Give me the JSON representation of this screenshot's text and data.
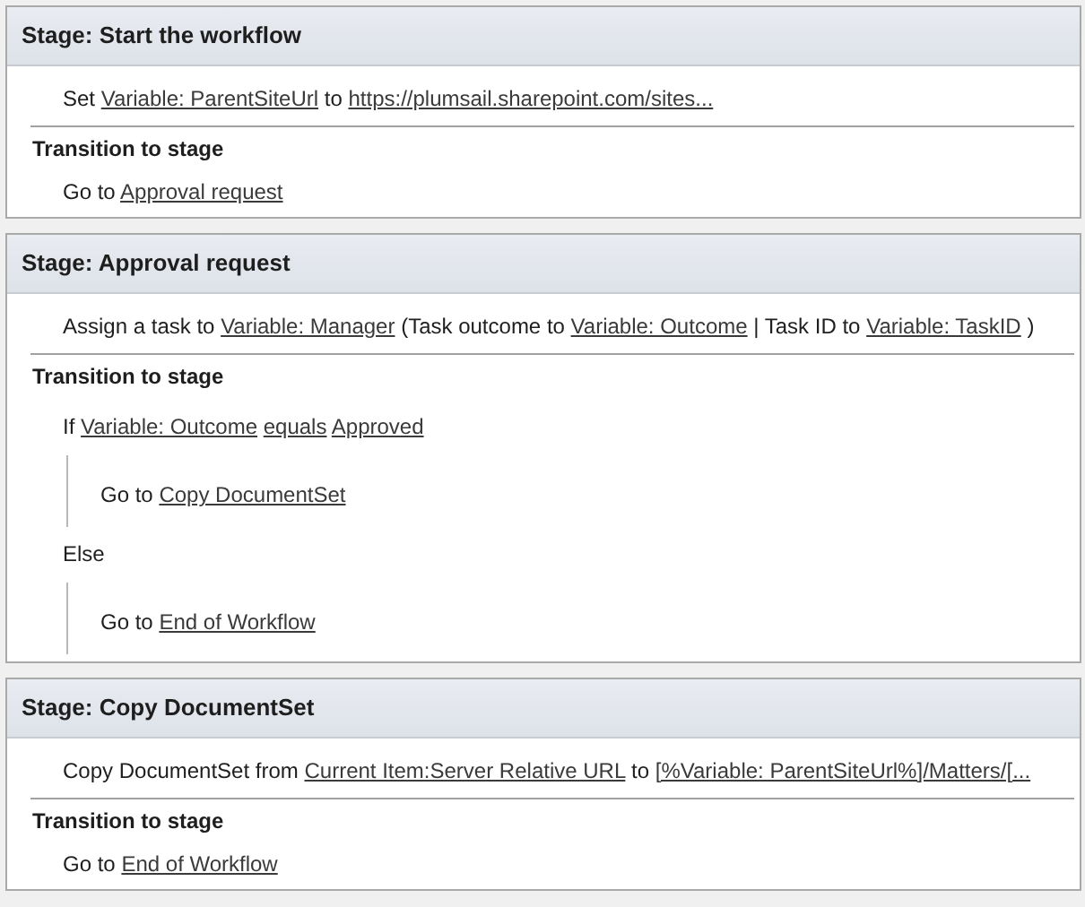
{
  "stages": [
    {
      "title": "Stage: Start the workflow",
      "actions": [
        {
          "parts": [
            {
              "kind": "text",
              "text": "Set"
            },
            {
              "kind": "link",
              "text": "Variable: ParentSiteUrl"
            },
            {
              "kind": "text",
              "text": "to"
            },
            {
              "kind": "link",
              "text": "https://plumsail.sharepoint.com/sites..."
            }
          ]
        }
      ],
      "transition": {
        "heading": "Transition to stage",
        "steps": [
          {
            "kind": "line",
            "parts": [
              {
                "kind": "text",
                "text": "Go to"
              },
              {
                "kind": "link",
                "text": "Approval request"
              }
            ]
          }
        ]
      }
    },
    {
      "title": "Stage: Approval request",
      "actions": [
        {
          "parts": [
            {
              "kind": "text",
              "text": "Assign a task to"
            },
            {
              "kind": "link",
              "text": "Variable: Manager"
            },
            {
              "kind": "text",
              "text": "(Task outcome to"
            },
            {
              "kind": "link",
              "text": "Variable: Outcome"
            },
            {
              "kind": "text",
              "text": "| Task ID to"
            },
            {
              "kind": "link",
              "text": "Variable: TaskID"
            },
            {
              "kind": "text",
              "text": ")"
            }
          ]
        }
      ],
      "transition": {
        "heading": "Transition to stage",
        "steps": [
          {
            "kind": "branch",
            "parts": [
              {
                "kind": "text",
                "text": "If"
              },
              {
                "kind": "link",
                "text": "Variable: Outcome"
              },
              {
                "kind": "link",
                "text": "equals"
              },
              {
                "kind": "link",
                "text": "Approved"
              }
            ],
            "children": [
              {
                "kind": "line",
                "parts": [
                  {
                    "kind": "text",
                    "text": "Go to"
                  },
                  {
                    "kind": "link",
                    "text": "Copy DocumentSet"
                  }
                ]
              }
            ]
          },
          {
            "kind": "branch",
            "parts": [
              {
                "kind": "text",
                "text": "Else"
              }
            ],
            "children": [
              {
                "kind": "line",
                "parts": [
                  {
                    "kind": "text",
                    "text": "Go to"
                  },
                  {
                    "kind": "link",
                    "text": "End of Workflow"
                  }
                ]
              }
            ]
          }
        ]
      }
    },
    {
      "title": "Stage: Copy DocumentSet",
      "actions": [
        {
          "parts": [
            {
              "kind": "text",
              "text": "Copy DocumentSet from"
            },
            {
              "kind": "link",
              "text": "Current Item:Server Relative URL"
            },
            {
              "kind": "text",
              "text": "to"
            },
            {
              "kind": "link",
              "text": "[%Variable: ParentSiteUrl%]/Matters/[..."
            }
          ]
        }
      ],
      "transition": {
        "heading": "Transition to stage",
        "steps": [
          {
            "kind": "line",
            "parts": [
              {
                "kind": "text",
                "text": "Go to"
              },
              {
                "kind": "link",
                "text": "End of Workflow"
              }
            ]
          }
        ]
      }
    }
  ]
}
